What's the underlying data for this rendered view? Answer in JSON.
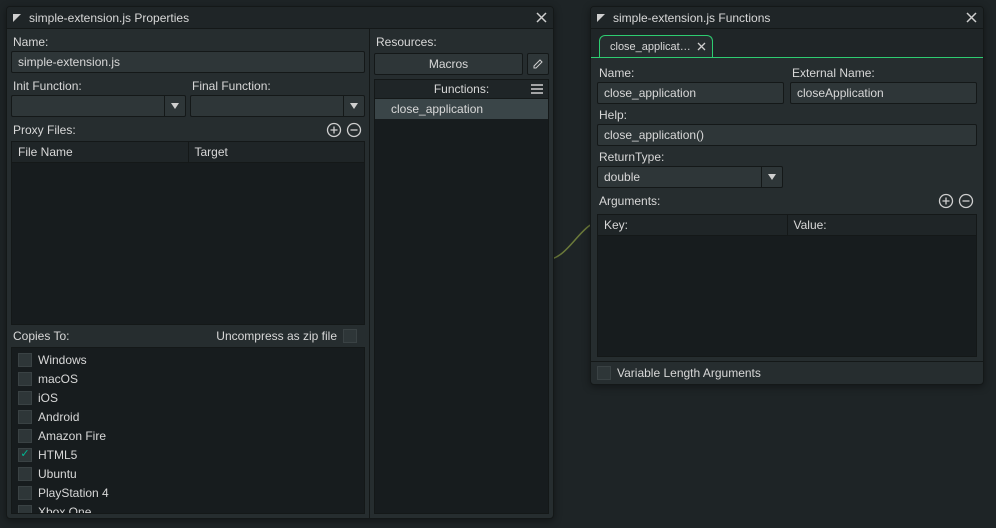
{
  "properties_window": {
    "title": "simple-extension.js Properties",
    "name_label": "Name:",
    "name_value": "simple-extension.js",
    "init_label": "Init Function:",
    "init_value": "",
    "final_label": "Final Function:",
    "final_value": "",
    "proxy_label": "Proxy Files:",
    "proxy_cols": {
      "file": "File Name",
      "target": "Target"
    },
    "copies_label": "Copies To:",
    "uncompress_label": "Uncompress as zip file",
    "uncompress_checked": false,
    "platforms": [
      {
        "name": "Windows",
        "checked": false
      },
      {
        "name": "macOS",
        "checked": false
      },
      {
        "name": "iOS",
        "checked": false
      },
      {
        "name": "Android",
        "checked": false
      },
      {
        "name": "Amazon Fire",
        "checked": false
      },
      {
        "name": "HTML5",
        "checked": true
      },
      {
        "name": "Ubuntu",
        "checked": false
      },
      {
        "name": "PlayStation 4",
        "checked": false
      },
      {
        "name": "Xbox One",
        "checked": false
      }
    ],
    "resources_label": "Resources:",
    "macros_btn": "Macros",
    "functions_header": "Functions:",
    "function_items": [
      "close_application"
    ]
  },
  "functions_window": {
    "title": "simple-extension.js Functions",
    "tab_label": "close_applicat…",
    "name_label": "Name:",
    "name_value": "close_application",
    "extname_label": "External Name:",
    "extname_value": "closeApplication",
    "help_label": "Help:",
    "help_value": "close_application()",
    "return_label": "ReturnType:",
    "return_value": "double",
    "args_label": "Arguments:",
    "args_cols": {
      "key": "Key:",
      "value": "Value:"
    },
    "varargs_label": "Variable Length Arguments",
    "varargs_checked": false
  }
}
